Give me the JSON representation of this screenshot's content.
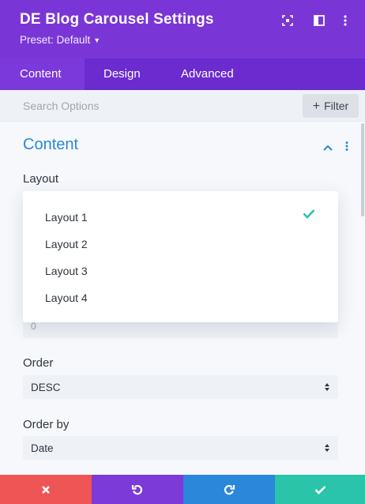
{
  "header": {
    "title": "DE Blog Carousel Settings",
    "preset": "Preset: Default",
    "icons": [
      "expand-icon",
      "split-view-icon",
      "more-options-icon"
    ],
    "color": "#7a35d6"
  },
  "tabs": [
    {
      "label": "Content",
      "active": true
    },
    {
      "label": "Design",
      "active": false
    },
    {
      "label": "Advanced",
      "active": false
    }
  ],
  "search": {
    "placeholder": "Search Options",
    "filter_label": "Filter"
  },
  "section": {
    "title": "Content",
    "accent": "#2b87da"
  },
  "layout_field": {
    "label": "Layout",
    "options": [
      "Layout 1",
      "Layout 2",
      "Layout 3",
      "Layout 4"
    ],
    "selected": "Layout 1",
    "check_color": "#29c4a9"
  },
  "hidden_field": {
    "value": "0"
  },
  "order_field": {
    "label": "Order",
    "value": "DESC"
  },
  "orderby_field": {
    "label": "Order by",
    "value": "Date"
  },
  "footer": {
    "buttons": [
      {
        "name": "cancel",
        "color": "#ef5555"
      },
      {
        "name": "undo",
        "color": "#7c3ad8"
      },
      {
        "name": "redo",
        "color": "#2b87da"
      },
      {
        "name": "save",
        "color": "#29c4a9"
      }
    ]
  }
}
